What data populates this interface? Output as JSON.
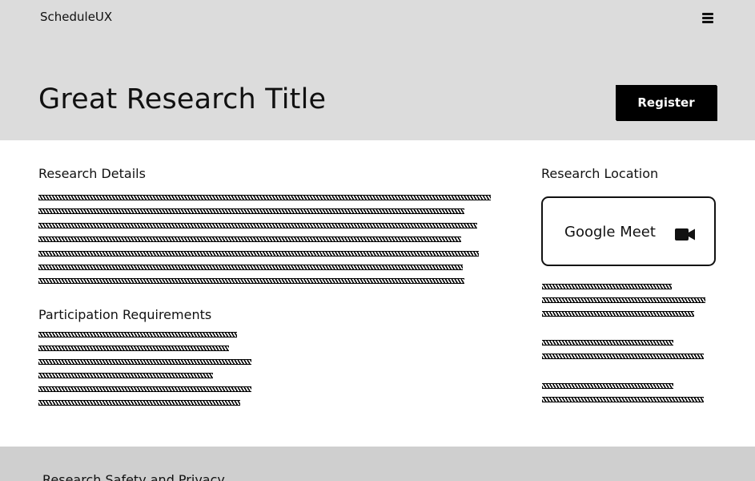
{
  "brand": "ScheduleUX",
  "icons": {
    "menu": "hamburger-menu-icon",
    "video": "video-camera-icon"
  },
  "colors": {
    "header_bg": "#dcdcdc",
    "footer_bg": "#cfcfcf",
    "button_bg": "#000000",
    "button_text": "#ffffff"
  },
  "hero": {
    "title": "Great Research Title",
    "register_label": "Register"
  },
  "details": {
    "heading": "Research Details"
  },
  "requirements": {
    "heading": "Participation Requirements"
  },
  "location": {
    "heading": "Research Location",
    "platform": "Google Meet"
  },
  "footer": {
    "heading": "Research Safety and Privacy"
  }
}
